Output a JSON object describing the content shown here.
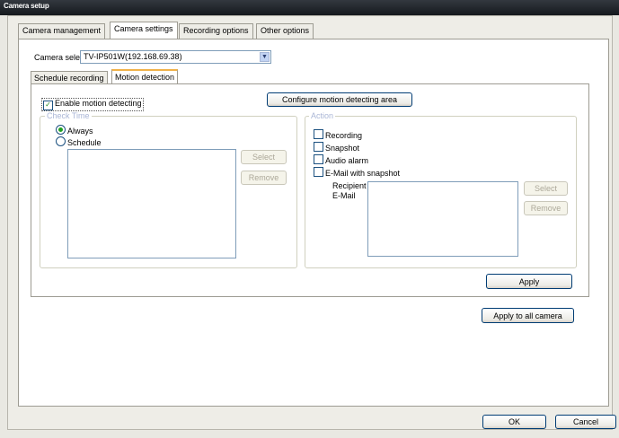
{
  "window": {
    "title": "Camera setup"
  },
  "tabs": [
    "Camera management",
    "Camera settings",
    "Recording options",
    "Other options"
  ],
  "camera_select": {
    "label": "Camera select",
    "value": "TV-IP501W(192.168.69.38)"
  },
  "subtabs": [
    "Schedule recording",
    "Motion detection"
  ],
  "motion": {
    "enable_label": "Enable motion detecting",
    "enable_checked": true,
    "configure_button": "Configure motion detecting area",
    "check_time": {
      "title": "Check Time",
      "always": "Always",
      "schedule": "Schedule",
      "selected": "Always",
      "select_button": "Select",
      "remove_button": "Remove"
    },
    "action": {
      "title": "Action",
      "recording": "Recording",
      "snapshot": "Snapshot",
      "audio_alarm": "Audio alarm",
      "email_snapshot": "E-Mail with snapshot",
      "recipient_label_line1": "Recipient",
      "recipient_label_line2": "E-Mail",
      "select_button": "Select",
      "remove_button": "Remove"
    },
    "apply_button": "Apply"
  },
  "apply_all_button": "Apply to all camera",
  "ok_button": "OK",
  "cancel_button": "Cancel",
  "colors": {
    "title_bar": "#1c2127",
    "window_bg": "#eeede7",
    "active_subtab_accent": "#f0b24a",
    "button_border": "#003c74"
  }
}
